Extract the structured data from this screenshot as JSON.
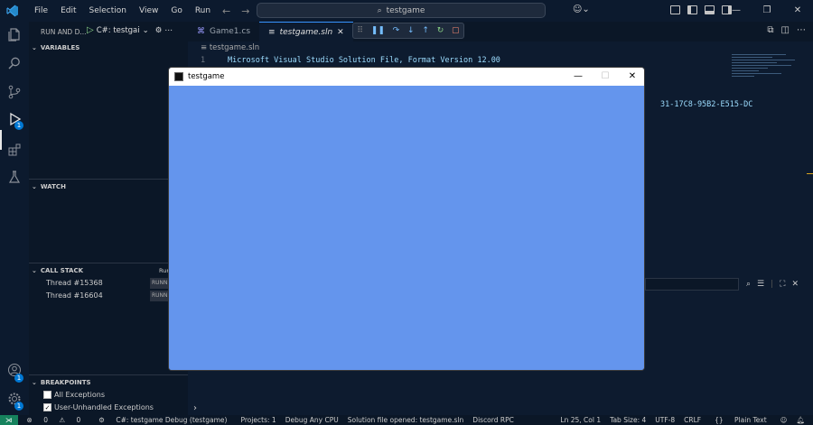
{
  "titlebar": {
    "menu": [
      "File",
      "Edit",
      "Selection",
      "View",
      "Go",
      "Run"
    ],
    "search_text": "testgame",
    "window_controls": {
      "minimize": "—",
      "restore": "❐",
      "close": "✕"
    }
  },
  "activity": {
    "explorer_icon": "files-icon",
    "search_icon": "search-icon",
    "scm_icon": "source-control-icon",
    "debug_icon": "run-debug-icon",
    "debug_badge": "1",
    "extensions_icon": "extensions-icon",
    "testing_icon": "flask-icon",
    "accounts_badge": "1",
    "manage_badge": "1"
  },
  "sidebar": {
    "title": "RUN AND D...",
    "config": "C#: testgai",
    "sections": {
      "variables": "VARIABLES",
      "watch": "WATCH",
      "call_stack": "CALL STACK",
      "call_stack_status": "Run",
      "breakpoints": "BREAKPOINTS"
    },
    "threads": [
      {
        "name": "Thread #15368",
        "state": "RUNN"
      },
      {
        "name": "Thread #16604",
        "state": "RUNN"
      }
    ],
    "breakpoints": [
      {
        "label": "All Exceptions",
        "checked": false
      },
      {
        "label": "User-Unhandled Exceptions",
        "checked": true
      }
    ]
  },
  "editor": {
    "tabs": [
      {
        "label": "Game1.cs",
        "active": false
      },
      {
        "label": "testgame.sln",
        "active": true
      }
    ],
    "breadcrumb": "testgame.sln",
    "lines": [
      {
        "num": "1",
        "text": "Microsoft Visual Studio Solution File, Format Version 12.00"
      }
    ],
    "guid_fragment": "31-17C8-95B2-E515-DC"
  },
  "game_window": {
    "title": "testgame",
    "background": "#6495ed",
    "controls": {
      "minimize": "—",
      "maximize": "☐",
      "close": "✕"
    }
  },
  "status": {
    "errors": "0",
    "warnings": "0",
    "debug_config": "C#: testgame Debug (testgame)",
    "projects": "Projects: 1",
    "debug_cpu": "Debug Any CPU",
    "solution": "Solution file opened: testgame.sln",
    "rpc": "Discord RPC",
    "position": "Ln 25, Col 1",
    "tab_size": "Tab Size: 4",
    "encoding": "UTF-8",
    "eol": "CRLF",
    "language": "Plain Text"
  },
  "colors": {
    "accent": "#0078d4",
    "remote": "#16825d",
    "game_bg": "#6495ed"
  }
}
